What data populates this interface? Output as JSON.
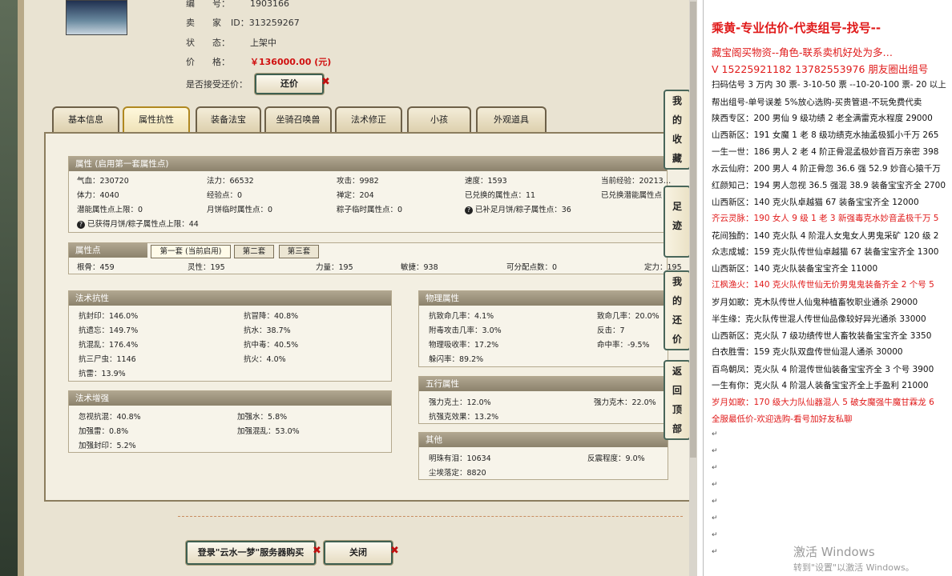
{
  "item": {
    "number_label": "编　　号：",
    "number": "1903166",
    "seller_label": "卖　　家",
    "seller_id": "ID：313259267",
    "status_label": "状　　态：",
    "status": "上架中",
    "price_label": "价　　格：",
    "price": "￥136000.00 (元)",
    "counter_label": "是否接受还价：",
    "counter_button": "还价"
  },
  "tabs": [
    "基本信息",
    "属性抗性",
    "装备法宝",
    "坐骑召唤兽",
    "法术修正",
    "小孩",
    "外观道具"
  ],
  "attrs": {
    "title": "属性 (启用第一套属性点)",
    "r1": [
      "气血：230720",
      "法力：66532",
      "攻击：9982",
      "速度：1593",
      "当前经验：20213…"
    ],
    "r2": [
      "体力：4040",
      "经验点：0",
      "禅定：204",
      "已兑换的属性点：11",
      "已兑换潜能属性点"
    ],
    "r3": [
      "潜能属性点上限：0",
      "月饼临时属性点：0",
      "粽子临时属性点：0",
      "已补足月饼/粽子属性点：36"
    ],
    "r4": "已获得月饼/粽子属性点上限：44"
  },
  "points": {
    "title": "属性点",
    "subtabs": [
      "第一套 (当前启用)",
      "第二套",
      "第三套"
    ],
    "row": [
      "根骨：459",
      "灵性：195",
      "力量：195",
      "敏捷：938",
      "可分配点数：0",
      "定力：195"
    ]
  },
  "spell_res": {
    "title": "法术抗性",
    "left": [
      "抗封印：146.0%",
      "抗遗忘：149.7%",
      "抗混乱：176.4%",
      "抗三尸虫：1146",
      "抗雷：13.9%"
    ],
    "right": [
      "抗冒降：40.8%",
      "抗水：38.7%",
      "抗中毒：40.5%",
      "抗火：4.0%"
    ]
  },
  "spell_boost": {
    "title": "法术增强",
    "left": [
      "忽视抗混：40.8%",
      "加强雷：0.8%",
      "加强封印：5.2%"
    ],
    "right": [
      "加强水：5.8%",
      "加强混乱：53.0%"
    ]
  },
  "phys": {
    "title": "物理属性",
    "left": [
      "抗致命几率：4.1%",
      "附毒攻击几率：3.0%",
      "物理吸收率：17.2%",
      "躲闪率：89.2%"
    ],
    "right": [
      "致命几率：20.0%",
      "反击：7",
      "命中率：-9.5%"
    ]
  },
  "five": {
    "title": "五行属性",
    "left": [
      "强力克土：12.0%",
      "抗强克效果：13.2%"
    ],
    "right": [
      "强力克木：22.0%"
    ]
  },
  "other": {
    "title": "其他",
    "left": [
      "明珠有泪：10634",
      "尘埃落定：8820"
    ],
    "right": [
      "反震程度：9.0%"
    ]
  },
  "bottom": {
    "login_button": "登录\"云水一梦\"服务器购买",
    "close_button": "关闭"
  },
  "side_tabs": [
    "我的收藏",
    "足迹",
    "我的还价",
    "返回顶部"
  ],
  "doc": {
    "title": "乘黄-专业估价-代卖组号-找号--",
    "lines": [
      {
        "t": "藏宝阁买物资--角色-联系卖机好处为多…",
        "red": true
      },
      {
        "t": "V 15225921182   13782553976 朋友圈出组号",
        "red": true
      },
      {
        "t": "扫码估号 3 万内 30 票- 3-10-50 票  --10-20-100 票- 20 以上",
        "red": false
      },
      {
        "t": "帮出组号-单号误差 5%放心选购-买贵管退-不玩免费代卖",
        "red": false
      },
      {
        "t": "陕西专区：200 男仙 9 级功绩 2 老全满雷克水程度 29000",
        "red": false
      },
      {
        "t": "山西新区：191 女魔 1 老 8 级功绩克水抽孟极狐小千万 265",
        "red": false
      },
      {
        "t": "一生一世：186 男人 2 老 4 阶正骨混孟极妙音百万亲密 398",
        "red": false
      },
      {
        "t": "水云仙府：200 男人 4 阶正骨忽 36.6 强 52.9 妙音心猿千万",
        "red": false
      },
      {
        "t": "红颜知己：194 男人忽视 36.5 强混 38.9 装备宝宝齐全 2700",
        "red": false
      },
      {
        "t": "山西新区：140 克火队卓越猫 67 装备宝宝齐全 12000",
        "red": false
      },
      {
        "t": "齐云灵脉：190 女人 9 级 1 老 3 新强毒克水妙音孟极千万 5",
        "red": true
      },
      {
        "t": "花间独酌：140 克火队 4 阶混人女鬼女人男鬼采矿 120 级 2",
        "red": false
      },
      {
        "t": "众志成城：159 克火队传世仙卓越猫 67 装备宝宝齐全 1300",
        "red": false
      },
      {
        "t": "山西新区：140 克火队装备宝宝齐全 11000",
        "red": false
      },
      {
        "t": "江枫渔火：140 克火队传世仙无价男鬼鬼装备齐全 2 个号 5",
        "red": true
      },
      {
        "t": "岁月如歌：克木队传世人仙鬼种植畜牧职业通杀 29000",
        "red": false
      },
      {
        "t": "半生缘：克火队传世混人传世仙品像较好异光通杀 33000",
        "red": false
      },
      {
        "t": "山西新区：克火队 7 级功绩传世人畜牧装备宝宝齐全 3350",
        "red": false
      },
      {
        "t": "白衣胜雪：159 克火队双盘传世仙混人通杀 30000",
        "red": false
      },
      {
        "t": "百鸟朝凤：克火队 4 阶混传世仙装备宝宝齐全 3 个号 3900",
        "red": false
      },
      {
        "t": "一生有你：克火队 4 阶混人装备宝宝齐全上手盈利 21000",
        "red": false
      },
      {
        "t": "岁月如歌：170 级大力队仙器混人 5 破女魔强牛魔甘霖龙 6",
        "red": true
      },
      {
        "t": "全服最低价-欢迎选购-看号加好友私聊",
        "red": true
      }
    ],
    "watermark_title": "激活 Windows",
    "watermark_sub": "转到\"设置\"以激活 Windows。"
  }
}
